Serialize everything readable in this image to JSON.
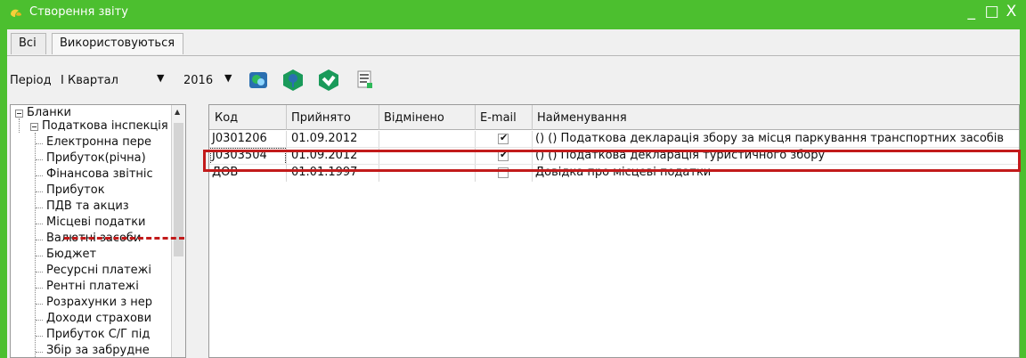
{
  "window": {
    "title": "Створення звіту",
    "controls": [
      "_",
      "□",
      "X"
    ]
  },
  "tabs": [
    {
      "label": "Всі",
      "active": false
    },
    {
      "label": "Використовуються",
      "active": true
    }
  ],
  "toolbar": {
    "period_label": "Період",
    "period_value": "I Квартал",
    "year_value": "2016",
    "icons": [
      "filter-icon",
      "pin-icon",
      "check-icon",
      "report-icon"
    ]
  },
  "tree": {
    "root": "Бланки",
    "group": "Податкова інспекція",
    "items": [
      "Електронна пере",
      "Прибуток(річна)",
      "Фінансова звітніс",
      "Прибуток",
      "ПДВ та акциз",
      "Місцеві податки",
      "Валютні засоби",
      "Бюджет",
      "Ресурсні платежі",
      "Рентні платежі",
      "Розрахунки з нер",
      "Доходи страхови",
      "Прибуток С/Г під",
      "Збір за забрудне"
    ]
  },
  "grid": {
    "columns": [
      "Код",
      "Прийнято",
      "Відмінено",
      "E-mail",
      "Найменування"
    ],
    "rows": [
      {
        "code": "J0301206",
        "accepted": "01.09.2012",
        "cancelled": "",
        "email": true,
        "name": "() ()  Податкова декларація збору за місця паркування транспортних засобів"
      },
      {
        "code": "J0303504",
        "accepted": "01.09.2012",
        "cancelled": "",
        "email": true,
        "name": "() ()  Податкова декларація туристичного збору"
      },
      {
        "code": "ДОВ",
        "accepted": "01.01.1997",
        "cancelled": "",
        "email": false,
        "name": "Довідка про місцеві податки"
      }
    ]
  },
  "colors": {
    "titlebar": "#4cbf2f",
    "highlight": "#c21b1b",
    "toolbar_green": "#1a9a5a",
    "toolbar_blue": "#2a6fb0"
  }
}
